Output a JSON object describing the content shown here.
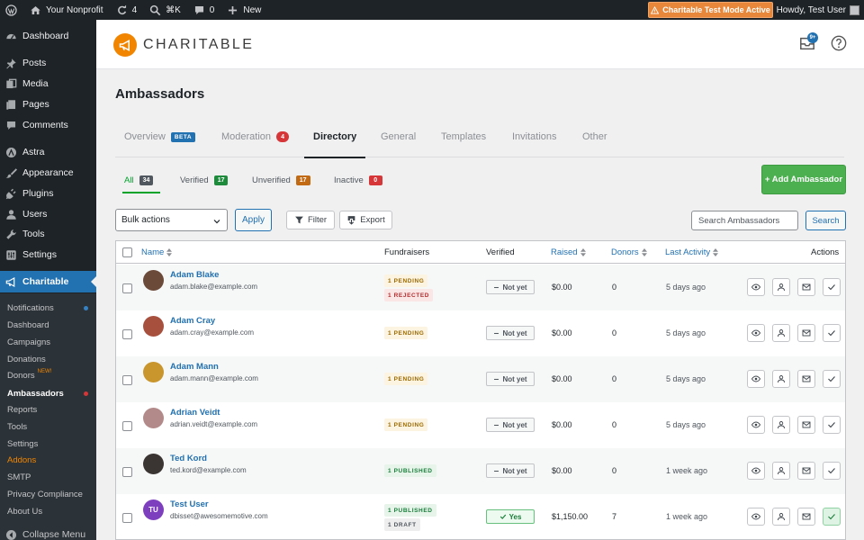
{
  "adminbar": {
    "site_name": "Your Nonprofit",
    "updates_count": "4",
    "shortcut": "⌘K",
    "comments_count": "0",
    "new_label": "New",
    "test_mode": "Charitable Test Mode Active",
    "howdy": "Howdy, Test User"
  },
  "sidebar": {
    "items": [
      {
        "label": "Dashboard",
        "icon": "dashboard-icon"
      },
      {
        "label": "Posts",
        "icon": "pin-icon"
      },
      {
        "label": "Media",
        "icon": "media-icon"
      },
      {
        "label": "Pages",
        "icon": "pages-icon"
      },
      {
        "label": "Comments",
        "icon": "comment-icon"
      },
      {
        "label": "Astra",
        "icon": "astra-icon"
      },
      {
        "label": "Appearance",
        "icon": "brush-icon"
      },
      {
        "label": "Plugins",
        "icon": "plug-icon"
      },
      {
        "label": "Users",
        "icon": "user-icon"
      },
      {
        "label": "Tools",
        "icon": "wrench-icon"
      },
      {
        "label": "Settings",
        "icon": "sliders-icon"
      }
    ],
    "charitable_label": "Charitable",
    "submenu": [
      {
        "label": "Notifications"
      },
      {
        "label": "Dashboard"
      },
      {
        "label": "Campaigns"
      },
      {
        "label": "Donations"
      },
      {
        "label": "Donors",
        "badge": "NEW!"
      },
      {
        "label": "Ambassadors"
      },
      {
        "label": "Reports"
      },
      {
        "label": "Tools"
      },
      {
        "label": "Settings"
      },
      {
        "label": "Addons"
      },
      {
        "label": "SMTP"
      },
      {
        "label": "Privacy Compliance"
      },
      {
        "label": "About Us"
      }
    ],
    "collapse_label": "Collapse Menu"
  },
  "header": {
    "brand": "CHARITABLE",
    "inbox_badge": "9+"
  },
  "page_title": "Ambassadors",
  "tabs": [
    {
      "label": "Overview",
      "badge": "BETA"
    },
    {
      "label": "Moderation",
      "count": "4"
    },
    {
      "label": "Directory"
    },
    {
      "label": "General"
    },
    {
      "label": "Templates"
    },
    {
      "label": "Invitations"
    },
    {
      "label": "Other"
    }
  ],
  "status_tabs": [
    {
      "label": "All",
      "count": "34",
      "color": "#50575e"
    },
    {
      "label": "Verified",
      "count": "17",
      "color": "#1e8a3c"
    },
    {
      "label": "Unverified",
      "count": "17",
      "color": "#c26a13"
    },
    {
      "label": "Inactive",
      "count": "0",
      "color": "#d63638"
    }
  ],
  "add_button": "+ Add Ambassador",
  "toolbar": {
    "bulk_actions": "Bulk actions",
    "apply": "Apply",
    "filter": "Filter",
    "export": "Export",
    "search_placeholder": "Search Ambassadors",
    "search_button": "Search"
  },
  "table": {
    "headers": {
      "name": "Name",
      "fundraisers": "Fundraisers",
      "verified": "Verified",
      "raised": "Raised",
      "donors": "Donors",
      "last_activity": "Last Activity",
      "actions": "Actions"
    },
    "rows": [
      {
        "name": "Adam Blake",
        "email": "adam.blake@example.com",
        "tags": [
          "1 PENDING",
          "1 REJECTED"
        ],
        "verified": "Not yet",
        "raised": "$0.00",
        "donors": "0",
        "last_activity": "5 days ago",
        "avatar_color": "#6b4a3a"
      },
      {
        "name": "Adam Cray",
        "email": "adam.cray@example.com",
        "tags": [
          "1 PENDING"
        ],
        "verified": "Not yet",
        "raised": "$0.00",
        "donors": "0",
        "last_activity": "5 days ago",
        "avatar_color": "#a8503e"
      },
      {
        "name": "Adam Mann",
        "email": "adam.mann@example.com",
        "tags": [
          "1 PENDING"
        ],
        "verified": "Not yet",
        "raised": "$0.00",
        "donors": "0",
        "last_activity": "5 days ago",
        "avatar_color": "#c9962e"
      },
      {
        "name": "Adrian Veidt",
        "email": "adrian.veidt@example.com",
        "tags": [
          "1 PENDING"
        ],
        "verified": "Not yet",
        "raised": "$0.00",
        "donors": "0",
        "last_activity": "5 days ago",
        "avatar_color": "#b38a8a"
      },
      {
        "name": "Ted Kord",
        "email": "ted.kord@example.com",
        "tags": [
          "1 PUBLISHED"
        ],
        "verified": "Not yet",
        "raised": "$0.00",
        "donors": "0",
        "last_activity": "1 week ago",
        "avatar_color": "#3a3432"
      },
      {
        "name": "Test User",
        "email": "dbisset@awesomemotive.com",
        "initials": "TU",
        "tags": [
          "1 PUBLISHED",
          "1 DRAFT"
        ],
        "verified": "Yes",
        "raised": "$1,150.00",
        "donors": "7",
        "last_activity": "1 week ago",
        "avatar_color": "#7e3fbf"
      }
    ]
  }
}
